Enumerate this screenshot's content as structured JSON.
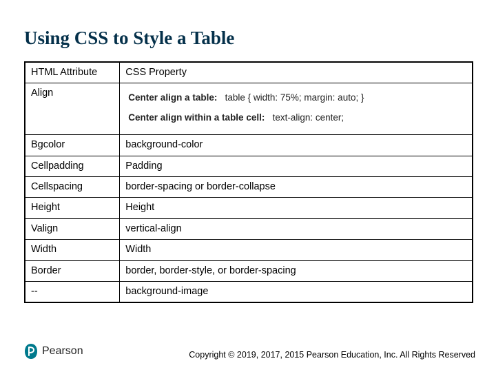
{
  "title": "Using CSS to Style a Table",
  "headers": {
    "a": "HTML Attribute",
    "b": "CSS Property"
  },
  "alignRow": {
    "attr": "Align",
    "line1Label": "Center align a table:",
    "line1Code": "table { width: 75%; margin: auto; }",
    "line2Label": "Center align within a table cell:",
    "line2Code": "text-align: center;"
  },
  "rows": [
    {
      "a": "Bgcolor",
      "b": "background-color"
    },
    {
      "a": "Cellpadding",
      "b": "Padding"
    },
    {
      "a": "Cellspacing",
      "b": "border-spacing or border-collapse"
    },
    {
      "a": "Height",
      "b": "Height"
    },
    {
      "a": "Valign",
      "b": "vertical-align"
    },
    {
      "a": "Width",
      "b": "Width"
    },
    {
      "a": "Border",
      "b": "border, border-style, or border-spacing"
    },
    {
      "a": "--",
      "b": "background-image"
    }
  ],
  "brand": "Pearson",
  "copyright": "Copyright © 2019, 2017, 2015 Pearson Education, Inc. All Rights Reserved"
}
